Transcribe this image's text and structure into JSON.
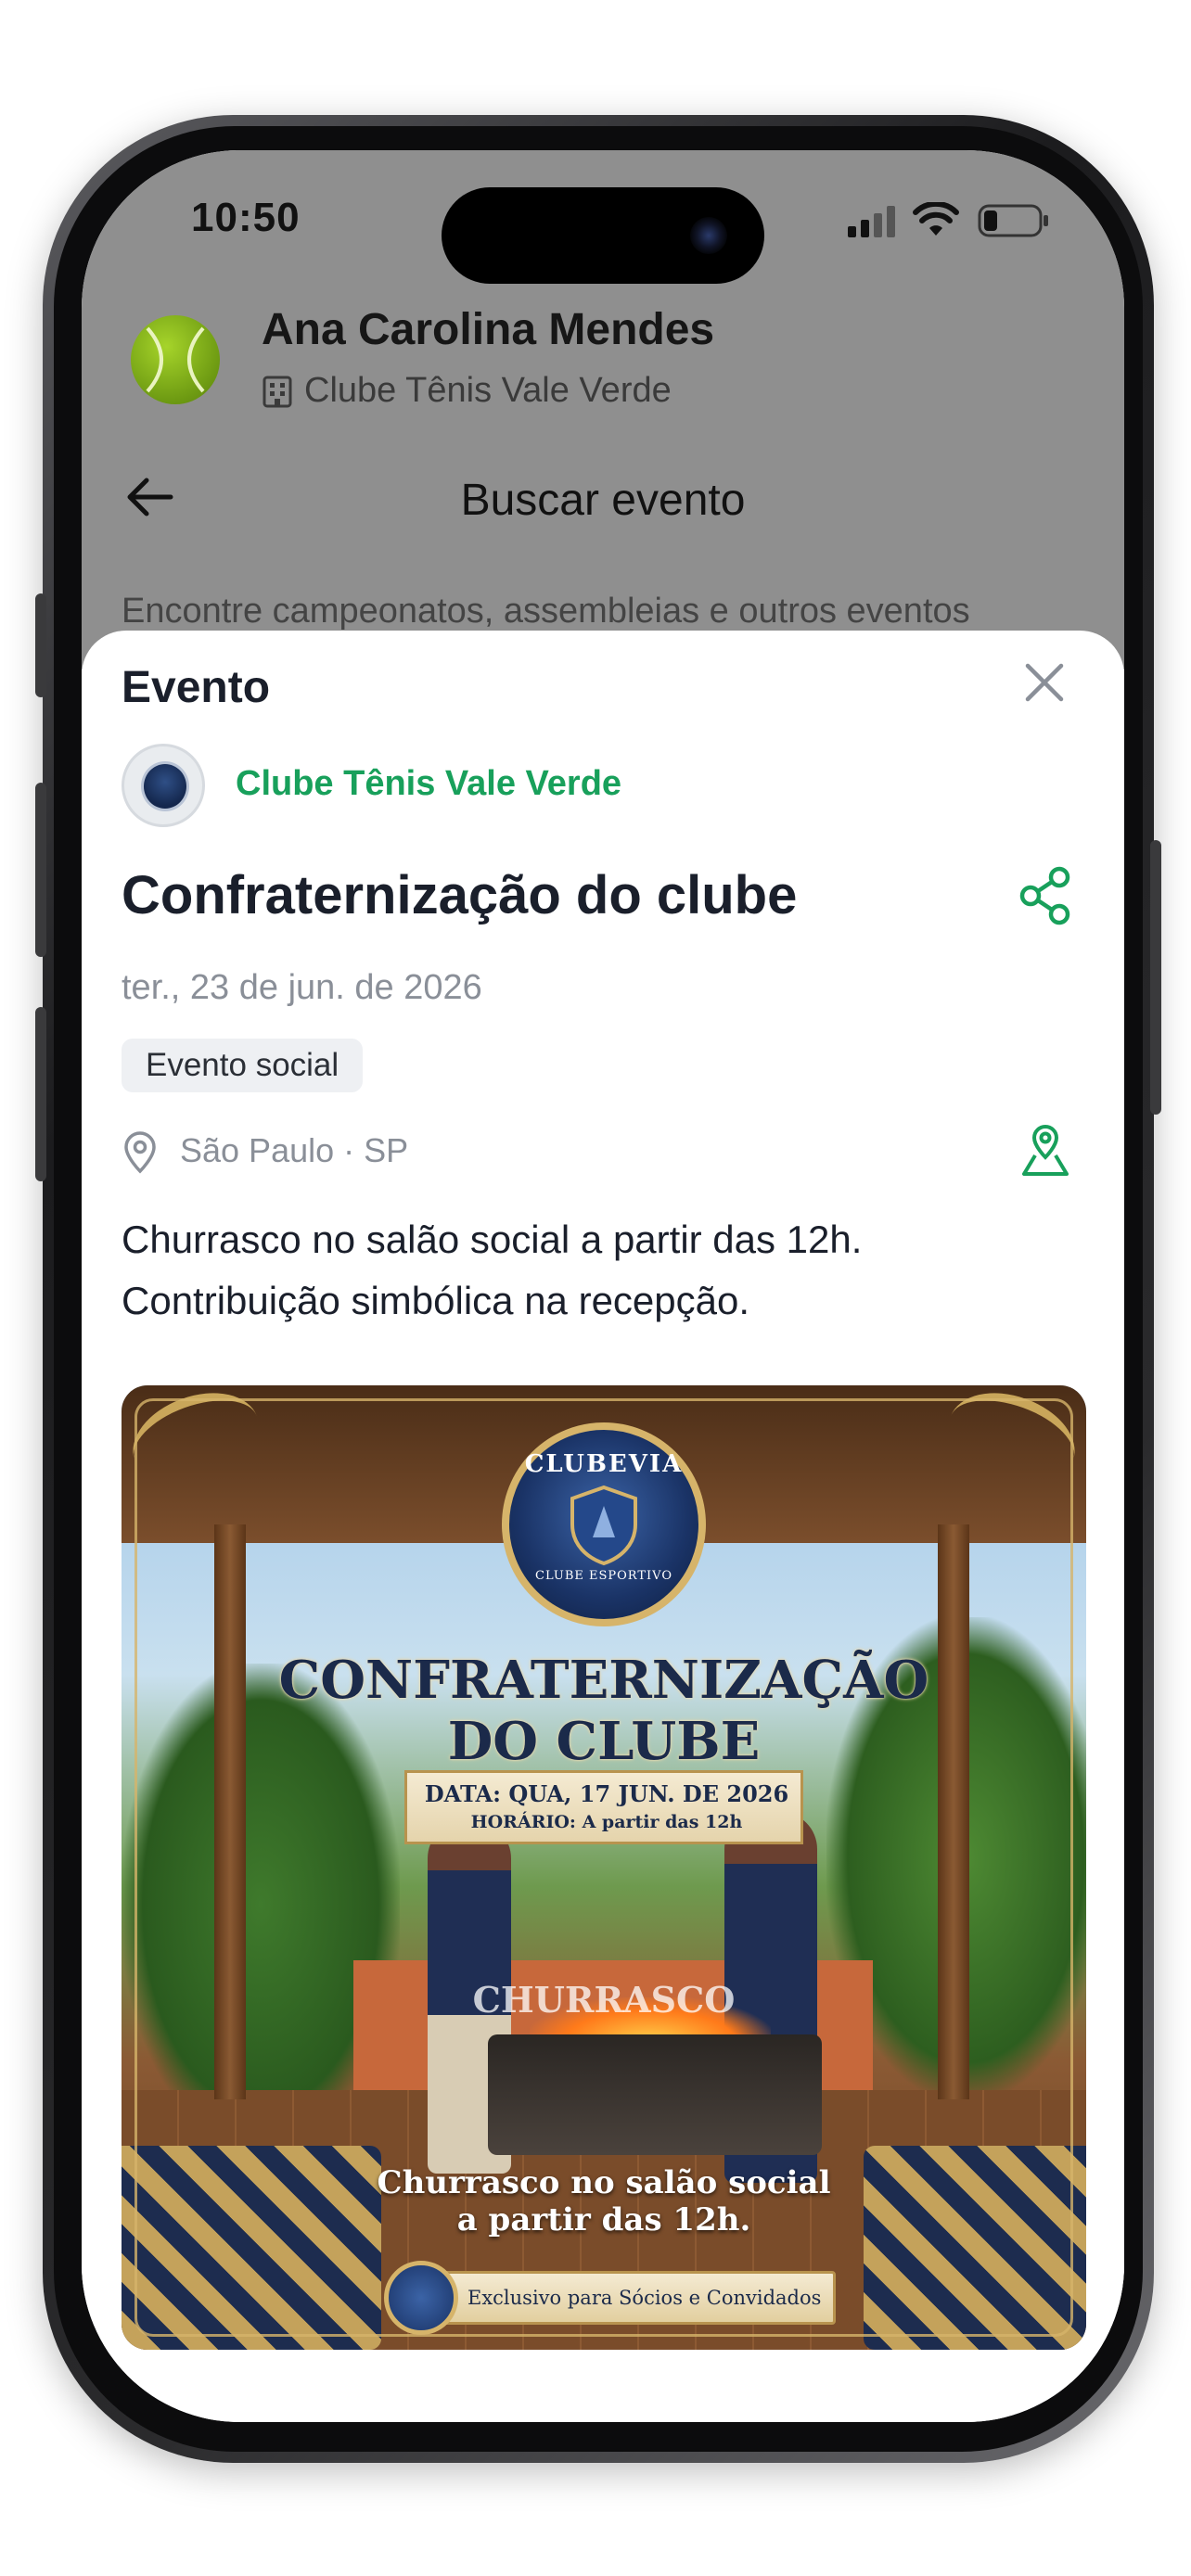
{
  "status_bar": {
    "time": "10:50"
  },
  "profile": {
    "name": "Ana Carolina Mendes",
    "club": "Clube Tênis Vale Verde"
  },
  "header": {
    "title": "Buscar evento"
  },
  "search": {
    "hint": "Encontre campeonatos, assembleias e outros eventos"
  },
  "sheet": {
    "title": "Evento",
    "club_name": "Clube Tênis Vale Verde",
    "event_title": "Confraternização do clube",
    "date": "ter., 23 de jun. de 2026",
    "badge": "Evento social",
    "location": "São Paulo · SP",
    "description_line1": "Churrasco no salão social a partir das 12h.",
    "description_line2": "Contribuição simbólica na recepção."
  },
  "poster": {
    "crest_top": "CLUBEVIA",
    "crest_bottom": "CLUBE ESPORTIVO",
    "title_line1": "CONFRATERNIZAÇÃO",
    "title_line2": "DO CLUBE",
    "date_line": "DATA: QUA, 17 JUN. DE 2026",
    "time_line": "HORÁRIO: A partir das 12h",
    "grill_text": "CHURRASCO",
    "bottom_line1": "Churrasco no salão social",
    "bottom_line2": "a partir das 12h.",
    "exclusive": "Exclusivo para Sócios e Convidados"
  },
  "colors": {
    "accent_green": "#18a05b",
    "text_dark": "#1a1f2b",
    "text_muted": "#8a8f98"
  },
  "icons": [
    "signal-icon",
    "wifi-icon",
    "battery-icon",
    "building-icon",
    "back-arrow-icon",
    "close-icon",
    "share-icon",
    "location-pin-icon",
    "map-pin-icon"
  ]
}
